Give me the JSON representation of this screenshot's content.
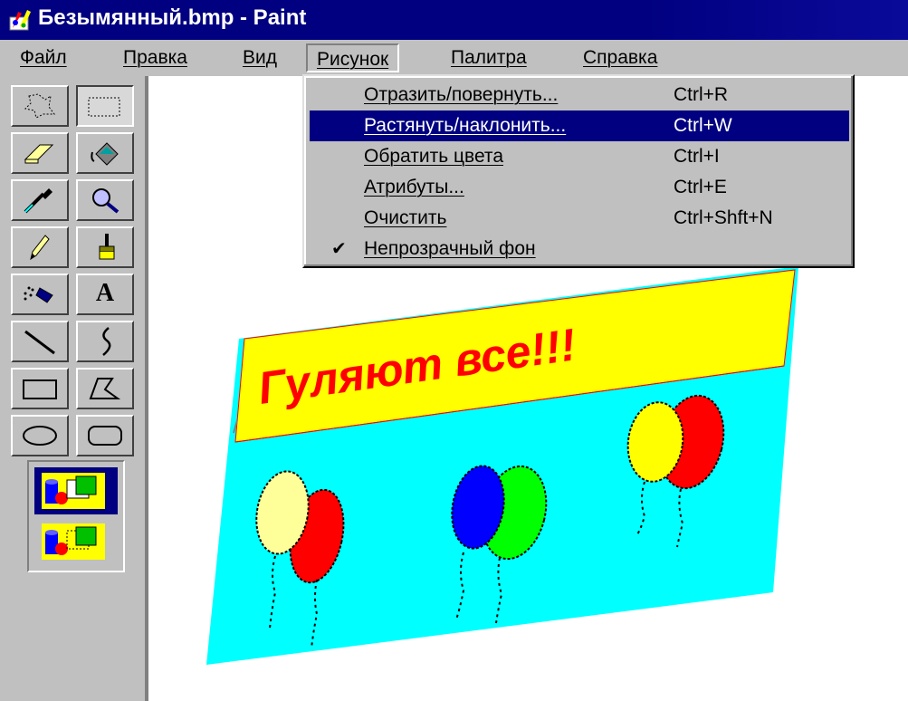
{
  "window": {
    "title": "Безымянный.bmp - Paint",
    "app_icon": "paint-app-icon"
  },
  "menubar": {
    "items": [
      {
        "label": "Файл"
      },
      {
        "label": "Правка"
      },
      {
        "label": "Вид"
      },
      {
        "label": "Рисунок",
        "active": true
      },
      {
        "label": "Палитра"
      },
      {
        "label": "Справка"
      }
    ]
  },
  "dropdown": {
    "items": [
      {
        "label": "Отразить/повернуть...",
        "shortcut": "Ctrl+R"
      },
      {
        "label": "Растянуть/наклонить...",
        "shortcut": "Ctrl+W",
        "highlighted": true
      },
      {
        "label": "Обратить цвета",
        "shortcut": "Ctrl+I"
      },
      {
        "label": "Атрибуты...",
        "shortcut": "Ctrl+E"
      },
      {
        "label": "Очистить",
        "shortcut": "Ctrl+Shft+N"
      },
      {
        "label": "Непрозрачный фон",
        "shortcut": "",
        "checked": true
      }
    ]
  },
  "toolbox": {
    "tools": [
      {
        "name": "free-select-icon"
      },
      {
        "name": "rect-select-icon",
        "pressed": true
      },
      {
        "name": "eraser-icon"
      },
      {
        "name": "fill-bucket-icon"
      },
      {
        "name": "color-picker-icon"
      },
      {
        "name": "magnifier-icon"
      },
      {
        "name": "pencil-icon"
      },
      {
        "name": "brush-icon"
      },
      {
        "name": "airbrush-icon"
      },
      {
        "name": "text-tool-icon"
      },
      {
        "name": "line-icon"
      },
      {
        "name": "curve-icon"
      },
      {
        "name": "rectangle-icon"
      },
      {
        "name": "polygon-icon"
      },
      {
        "name": "ellipse-icon"
      },
      {
        "name": "rounded-rect-icon"
      }
    ],
    "text_tool_glyph": "A",
    "options": [
      {
        "name": "opaque-background-option-icon",
        "selected": true
      },
      {
        "name": "transparent-background-option-icon",
        "selected": false
      }
    ]
  },
  "canvas": {
    "banner_text": "Гуляют все!!!",
    "colors": {
      "background": "#00ffff",
      "banner": "#ffff00",
      "banner_text": "#ff0000",
      "balloon_red": "#ff0000",
      "balloon_yellow": "#ffff00",
      "balloon_pale": "#ffff99",
      "balloon_blue": "#0000ff",
      "balloon_green": "#00ff00"
    }
  }
}
